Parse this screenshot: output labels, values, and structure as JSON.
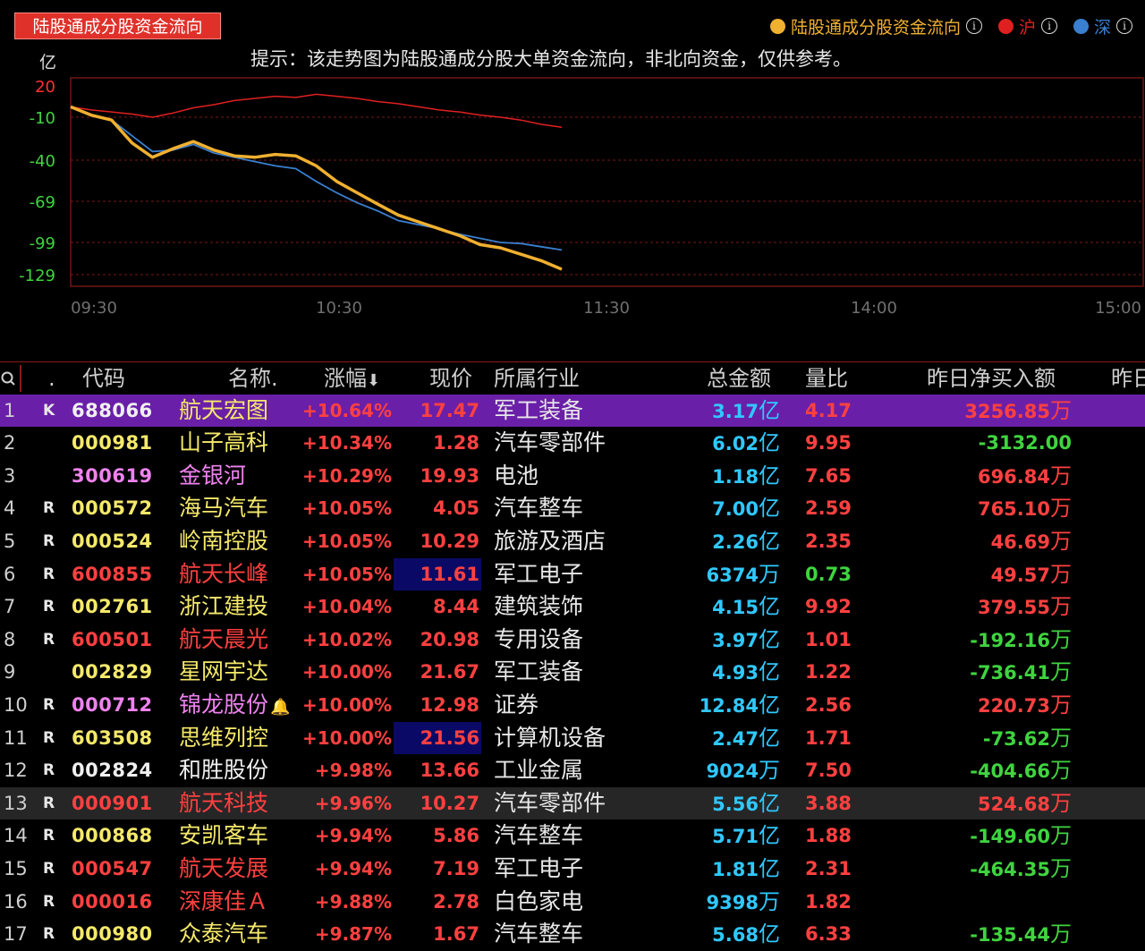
{
  "chart": {
    "tab_title": "陆股通成分股资金流向",
    "tip": "提示：该走势图为陆股通成分股大单资金流向，非北向资金，仅供参考。",
    "unit": "亿",
    "legend": [
      {
        "label": "陆股通成分股资金流向",
        "color": "#f0b030",
        "icon": "info-icon"
      },
      {
        "label": "沪",
        "color": "#e02020",
        "icon": "info-icon"
      },
      {
        "label": "深",
        "color": "#3a7fd0",
        "icon": "info-icon"
      }
    ],
    "y_ticks": [
      "20",
      "-10",
      "-40",
      "-69",
      "-99",
      "-129"
    ],
    "x_ticks": [
      "09:30",
      "10:30",
      "11:30",
      "14:00",
      "15:00"
    ]
  },
  "chart_data": {
    "type": "line",
    "ylabel": "亿",
    "ylim": [
      -140,
      25
    ],
    "x_axis": [
      "09:30",
      "10:30",
      "11:30",
      "14:00",
      "15:00"
    ],
    "series": [
      {
        "name": "陆股通成分股资金流向",
        "color": "#f0b030",
        "x": [
          "09:30",
          "09:35",
          "09:40",
          "09:45",
          "09:50",
          "09:55",
          "10:00",
          "10:05",
          "10:10",
          "10:15",
          "10:20",
          "10:25",
          "10:30",
          "10:35",
          "10:40",
          "10:45",
          "10:50",
          "10:55",
          "11:00",
          "11:05",
          "11:10",
          "11:15",
          "11:20",
          "11:25",
          "11:30"
        ],
        "values": [
          0,
          -8,
          -12,
          -28,
          -38,
          -32,
          -27,
          -33,
          -37,
          -38,
          -36,
          -37,
          -44,
          -55,
          -63,
          -71,
          -79,
          -84,
          -89,
          -94,
          -101,
          -104,
          -110,
          -116,
          -124
        ]
      },
      {
        "name": "沪",
        "color": "#e02020",
        "x": [
          "09:30",
          "09:35",
          "09:40",
          "09:45",
          "09:50",
          "09:55",
          "10:00",
          "10:05",
          "10:10",
          "10:15",
          "10:20",
          "10:25",
          "10:30",
          "10:35",
          "10:40",
          "10:45",
          "10:50",
          "10:55",
          "11:00",
          "11:05",
          "11:10",
          "11:15",
          "11:20",
          "11:25",
          "11:30"
        ],
        "values": [
          0,
          -3,
          -5,
          -7,
          -10,
          -6,
          -1,
          2,
          6,
          8,
          10,
          9,
          12,
          10,
          8,
          5,
          3,
          0,
          -3,
          -5,
          -8,
          -10,
          -12,
          -15,
          -17
        ]
      },
      {
        "name": "深",
        "color": "#3a7fd0",
        "x": [
          "09:30",
          "09:35",
          "09:40",
          "09:45",
          "09:50",
          "09:55",
          "10:00",
          "10:05",
          "10:10",
          "10:15",
          "10:20",
          "10:25",
          "10:30",
          "10:35",
          "10:40",
          "10:45",
          "10:50",
          "10:55",
          "11:00",
          "11:05",
          "11:10",
          "11:15",
          "11:20",
          "11:25",
          "11:30"
        ],
        "values": [
          0,
          -8,
          -12,
          -23,
          -34,
          -33,
          -29,
          -35,
          -38,
          -41,
          -44,
          -46,
          -55,
          -63,
          -70,
          -76,
          -83,
          -86,
          -89,
          -93,
          -96,
          -99,
          -100,
          -103,
          -106
        ]
      }
    ]
  },
  "table": {
    "headers": {
      "search_icon": "search-icon",
      "dot": ".",
      "code": "代码",
      "name": "名称.",
      "change": "涨幅",
      "price": "现价",
      "industry": "所属行业",
      "amount": "总金额",
      "ratio": "量比",
      "net_buy": "昨日净买入额",
      "extra": "昨日"
    },
    "rows": [
      {
        "idx": "1",
        "flag": "K",
        "code": "688066",
        "name": "航天宏图",
        "change": "+10.64%",
        "price": "17.47",
        "industry": "军工装备",
        "amount": "3.17",
        "amount_unit": "亿",
        "ratio": "4.17",
        "net": "3256.85",
        "net_unit": "万",
        "code_color": "#f0f0f0",
        "name_color": "#f5e96a",
        "ratio_color": "#ff4040",
        "net_color": "#ff4040",
        "state": "selected"
      },
      {
        "idx": "2",
        "flag": "",
        "code": "000981",
        "name": "山子高科",
        "change": "+10.34%",
        "price": "1.28",
        "industry": "汽车零部件",
        "amount": "6.02",
        "amount_unit": "亿",
        "ratio": "9.95",
        "net": "-3132.00",
        "net_unit": "",
        "code_color": "#f5e96a",
        "name_color": "#f5e96a",
        "ratio_color": "#ff4040",
        "net_color": "#3fd43f",
        "state": ""
      },
      {
        "idx": "3",
        "flag": "",
        "code": "300619",
        "name": "金银河",
        "change": "+10.29%",
        "price": "19.93",
        "industry": "电池",
        "amount": "1.18",
        "amount_unit": "亿",
        "ratio": "7.65",
        "net": "696.84",
        "net_unit": "万",
        "code_color": "#ee82ee",
        "name_color": "#ee82ee",
        "ratio_color": "#ff4040",
        "net_color": "#ff4040",
        "state": ""
      },
      {
        "idx": "4",
        "flag": "R",
        "code": "000572",
        "name": "海马汽车",
        "change": "+10.05%",
        "price": "4.05",
        "industry": "汽车整车",
        "amount": "7.00",
        "amount_unit": "亿",
        "ratio": "2.59",
        "net": "765.10",
        "net_unit": "万",
        "code_color": "#f5e96a",
        "name_color": "#f5e96a",
        "ratio_color": "#ff4040",
        "net_color": "#ff4040",
        "state": ""
      },
      {
        "idx": "5",
        "flag": "R",
        "code": "000524",
        "name": "岭南控股",
        "change": "+10.05%",
        "price": "10.29",
        "industry": "旅游及酒店",
        "amount": "2.26",
        "amount_unit": "亿",
        "ratio": "2.35",
        "net": "46.69",
        "net_unit": "万",
        "code_color": "#f5e96a",
        "name_color": "#f5e96a",
        "ratio_color": "#ff4040",
        "net_color": "#ff4040",
        "state": ""
      },
      {
        "idx": "6",
        "flag": "R",
        "code": "600855",
        "name": "航天长峰",
        "change": "+10.05%",
        "price": "11.61",
        "industry": "军工电子",
        "amount": "6374",
        "amount_unit": "万",
        "ratio": "0.73",
        "net": "49.57",
        "net_unit": "万",
        "code_color": "#ff4040",
        "name_color": "#ff4040",
        "ratio_color": "#3fd43f",
        "net_color": "#ff4040",
        "state": "price-hl"
      },
      {
        "idx": "7",
        "flag": "R",
        "code": "002761",
        "name": "浙江建投",
        "change": "+10.04%",
        "price": "8.44",
        "industry": "建筑装饰",
        "amount": "4.15",
        "amount_unit": "亿",
        "ratio": "9.92",
        "net": "379.55",
        "net_unit": "万",
        "code_color": "#f5e96a",
        "name_color": "#f5e96a",
        "ratio_color": "#ff4040",
        "net_color": "#ff4040",
        "state": ""
      },
      {
        "idx": "8",
        "flag": "R",
        "code": "600501",
        "name": "航天晨光",
        "change": "+10.02%",
        "price": "20.98",
        "industry": "专用设备",
        "amount": "3.97",
        "amount_unit": "亿",
        "ratio": "1.01",
        "net": "-192.16",
        "net_unit": "万",
        "code_color": "#ff4040",
        "name_color": "#ff4040",
        "ratio_color": "#ff4040",
        "net_color": "#3fd43f",
        "state": ""
      },
      {
        "idx": "9",
        "flag": "",
        "code": "002829",
        "name": "星网宇达",
        "change": "+10.00%",
        "price": "21.67",
        "industry": "军工装备",
        "amount": "4.93",
        "amount_unit": "亿",
        "ratio": "1.22",
        "net": "-736.41",
        "net_unit": "万",
        "code_color": "#f5e96a",
        "name_color": "#f5e96a",
        "ratio_color": "#ff4040",
        "net_color": "#3fd43f",
        "state": ""
      },
      {
        "idx": "10",
        "flag": "R",
        "code": "000712",
        "name": "锦龙股份",
        "change": "+10.00%",
        "price": "12.98",
        "industry": "证券",
        "amount": "12.84",
        "amount_unit": "亿",
        "ratio": "2.56",
        "net": "220.73",
        "net_unit": "万",
        "code_color": "#ee82ee",
        "name_color": "#ee82ee",
        "ratio_color": "#ff4040",
        "net_color": "#ff4040",
        "state": "bell"
      },
      {
        "idx": "11",
        "flag": "R",
        "code": "603508",
        "name": "思维列控",
        "change": "+10.00%",
        "price": "21.56",
        "industry": "计算机设备",
        "amount": "2.47",
        "amount_unit": "亿",
        "ratio": "1.71",
        "net": "-73.62",
        "net_unit": "万",
        "code_color": "#f5e96a",
        "name_color": "#f5e96a",
        "ratio_color": "#ff4040",
        "net_color": "#3fd43f",
        "state": "price-hl"
      },
      {
        "idx": "12",
        "flag": "R",
        "code": "002824",
        "name": "和胜股份",
        "change": "+9.98%",
        "price": "13.66",
        "industry": "工业金属",
        "amount": "9024",
        "amount_unit": "万",
        "ratio": "7.50",
        "net": "-404.66",
        "net_unit": "万",
        "code_color": "#f0f0f0",
        "name_color": "#f0f0f0",
        "ratio_color": "#ff4040",
        "net_color": "#3fd43f",
        "state": ""
      },
      {
        "idx": "13",
        "flag": "R",
        "code": "000901",
        "name": "航天科技",
        "change": "+9.96%",
        "price": "10.27",
        "industry": "汽车零部件",
        "amount": "5.56",
        "amount_unit": "亿",
        "ratio": "3.88",
        "net": "524.68",
        "net_unit": "万",
        "code_color": "#ff4040",
        "name_color": "#ff4040",
        "ratio_color": "#ff4040",
        "net_color": "#ff4040",
        "state": "hover"
      },
      {
        "idx": "14",
        "flag": "R",
        "code": "000868",
        "name": "安凯客车",
        "change": "+9.94%",
        "price": "5.86",
        "industry": "汽车整车",
        "amount": "5.71",
        "amount_unit": "亿",
        "ratio": "1.88",
        "net": "-149.60",
        "net_unit": "万",
        "code_color": "#f5e96a",
        "name_color": "#f5e96a",
        "ratio_color": "#ff4040",
        "net_color": "#3fd43f",
        "state": ""
      },
      {
        "idx": "15",
        "flag": "R",
        "code": "000547",
        "name": "航天发展",
        "change": "+9.94%",
        "price": "7.19",
        "industry": "军工电子",
        "amount": "1.81",
        "amount_unit": "亿",
        "ratio": "2.31",
        "net": "-464.35",
        "net_unit": "万",
        "code_color": "#ff4040",
        "name_color": "#ff4040",
        "ratio_color": "#ff4040",
        "net_color": "#3fd43f",
        "state": ""
      },
      {
        "idx": "16",
        "flag": "R",
        "code": "000016",
        "name": "深康佳Ａ",
        "change": "+9.88%",
        "price": "2.78",
        "industry": "白色家电",
        "amount": "9398",
        "amount_unit": "万",
        "ratio": "1.82",
        "net": "",
        "net_unit": "",
        "code_color": "#ff4040",
        "name_color": "#ff4040",
        "ratio_color": "#ff4040",
        "net_color": "#ff4040",
        "state": ""
      },
      {
        "idx": "17",
        "flag": "R",
        "code": "000980",
        "name": "众泰汽车",
        "change": "+9.87%",
        "price": "1.67",
        "industry": "汽车整车",
        "amount": "5.68",
        "amount_unit": "亿",
        "ratio": "6.33",
        "net": "-135.44",
        "net_unit": "万",
        "code_color": "#f5e96a",
        "name_color": "#f5e96a",
        "ratio_color": "#ff4040",
        "net_color": "#3fd43f",
        "state": ""
      }
    ]
  }
}
